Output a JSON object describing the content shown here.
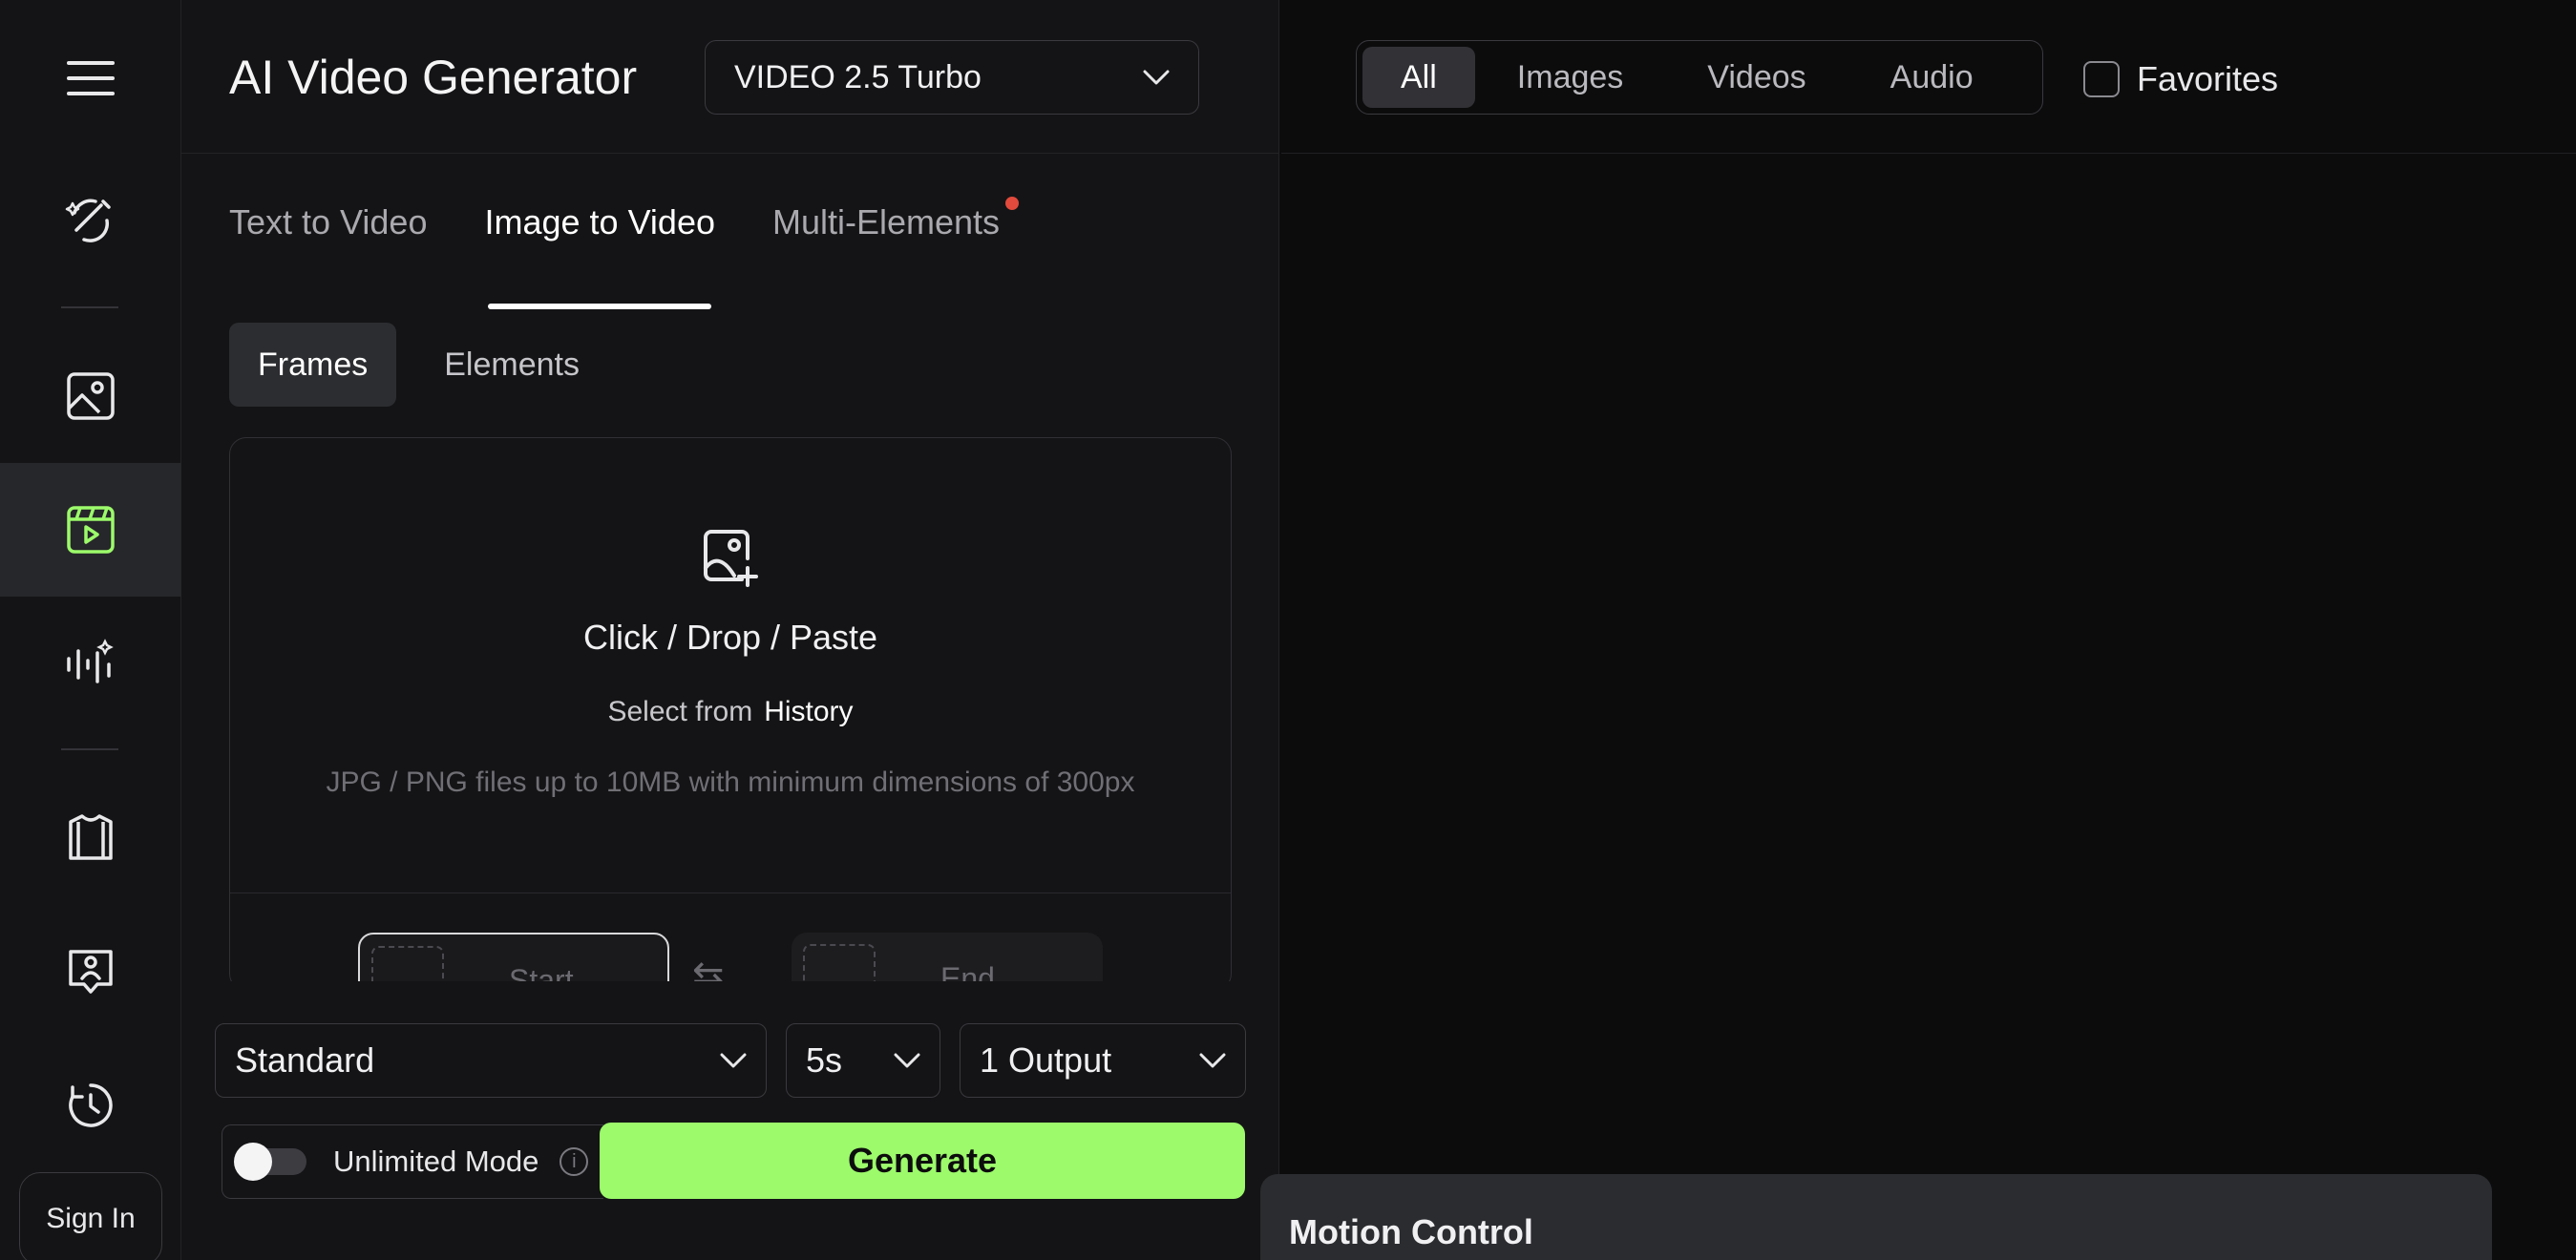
{
  "sidebar": {
    "items": [
      {
        "icon": "menu-icon"
      },
      {
        "icon": "magic-wand-icon"
      },
      {
        "icon": "image-icon"
      },
      {
        "icon": "video-icon",
        "active": true
      },
      {
        "icon": "audio-wave-icon"
      },
      {
        "icon": "shirt-icon"
      },
      {
        "icon": "avatar-frame-icon"
      },
      {
        "icon": "history-icon"
      }
    ],
    "sign_in_label": "Sign In",
    "active_color": "#9cfa6b"
  },
  "header": {
    "title": "AI Video Generator",
    "model_select": "VIDEO 2.5 Turbo"
  },
  "tabs": [
    {
      "label": "Text to Video",
      "active": false
    },
    {
      "label": "Image to Video",
      "active": true
    },
    {
      "label": "Multi-Elements",
      "active": false,
      "badge_dot": true
    }
  ],
  "subtabs": [
    {
      "label": "Frames",
      "active": true
    },
    {
      "label": "Elements",
      "active": false
    }
  ],
  "upload": {
    "main_text": "Click / Drop / Paste",
    "select_prefix": "Select from",
    "history_link": "History",
    "hint": "JPG / PNG files up to 10MB with minimum dimensions of 300px",
    "start_label": "Start",
    "end_label": "End"
  },
  "settings": {
    "mode": "Standard",
    "duration": "5s",
    "outputs": "1 Output",
    "unlimited_label": "Unlimited Mode",
    "unlimited_on": false,
    "generate_label": "Generate",
    "generate_color": "#9cfa6b"
  },
  "gallery": {
    "filters": [
      {
        "label": "All",
        "active": true
      },
      {
        "label": "Images",
        "active": false
      },
      {
        "label": "Videos",
        "active": false
      },
      {
        "label": "Audio",
        "active": false
      }
    ],
    "favorites_label": "Favorites",
    "favorites_checked": false
  },
  "motion_control": {
    "title": "Motion Control"
  }
}
